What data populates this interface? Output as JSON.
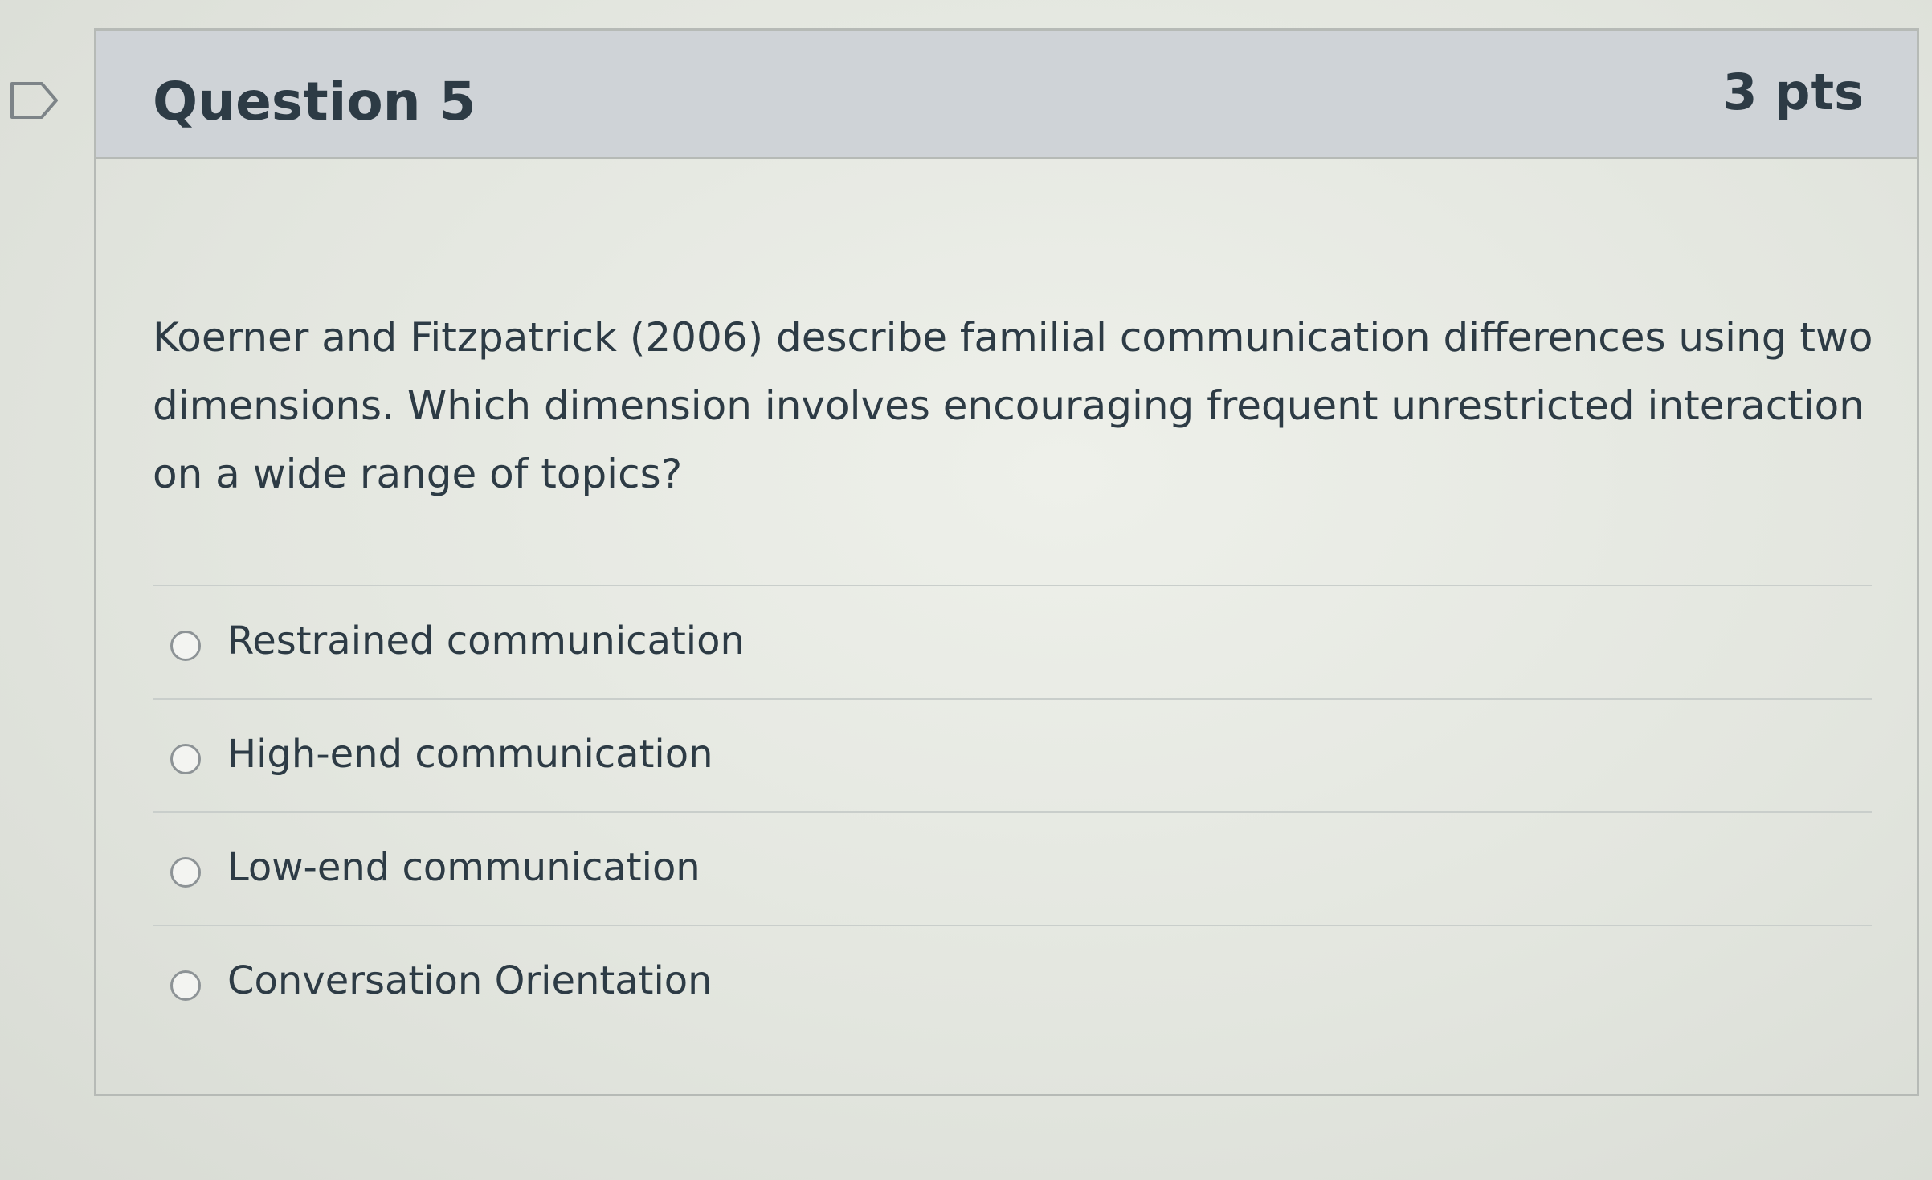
{
  "question": {
    "title": "Question 5",
    "points": "3 pts",
    "text": "Koerner and Fitzpatrick (2006) describe familial communication differences using two dimensions. Which dimension involves encouraging frequent unrestricted interaction on a wide range of topics?"
  },
  "answers": [
    {
      "label": "Restrained communication",
      "selected": false
    },
    {
      "label": "High-end communication",
      "selected": false
    },
    {
      "label": "Low-end communication",
      "selected": false
    },
    {
      "label": "Conversation Orientation",
      "selected": false
    }
  ],
  "icons": {
    "flag": "flag-question-icon",
    "radio": "radio-unselected-icon"
  },
  "colors": {
    "header_background": "#cfd3d7",
    "text": "#2d3b45",
    "border": "#b6bab6"
  }
}
